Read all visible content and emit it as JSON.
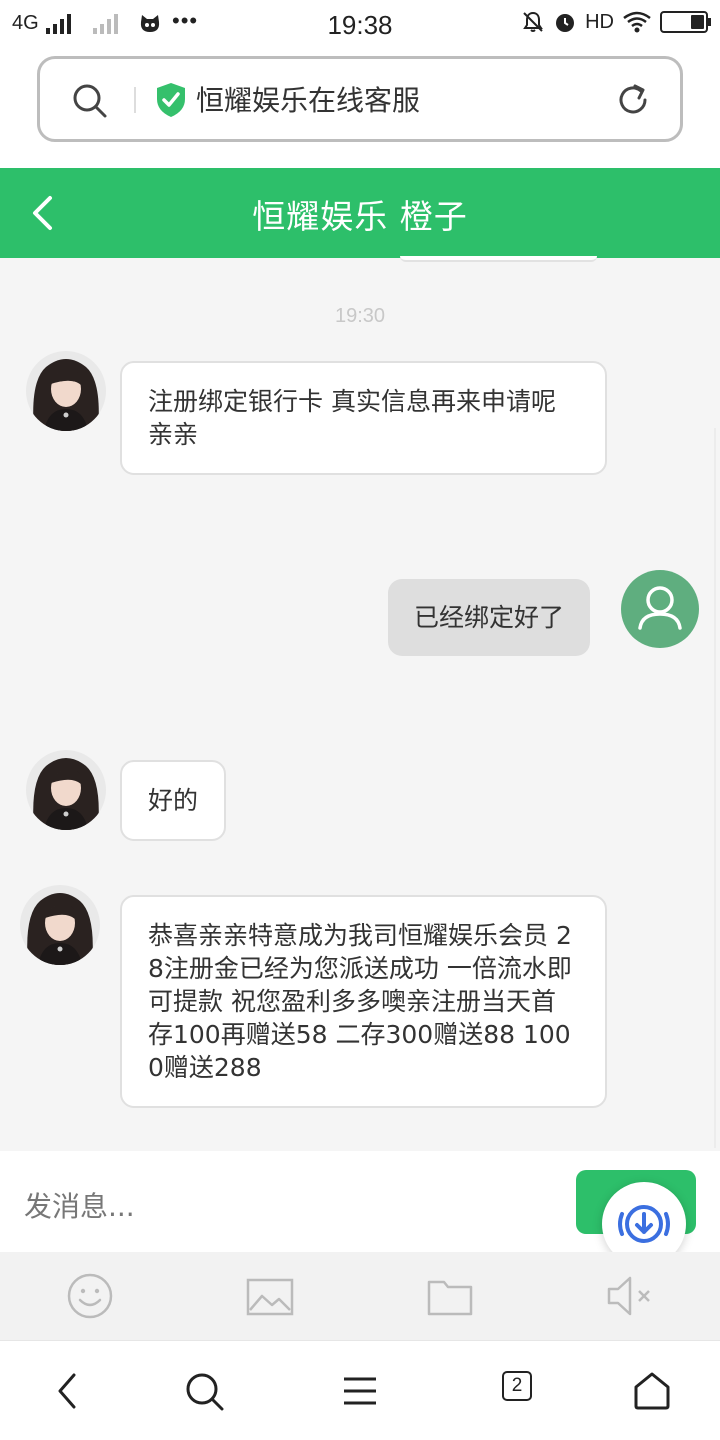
{
  "status_bar": {
    "network": "4G",
    "time": "19:38",
    "hd": "HD",
    "more_dots": "•••"
  },
  "browser": {
    "page_title": "恒耀娱乐在线客服"
  },
  "chat_header": {
    "title": "恒耀娱乐 橙子"
  },
  "messages": {
    "timestamp": "19:30",
    "items": [
      {
        "from": "agent",
        "text": "注册绑定银行卡 真实信息再来申请呢亲亲"
      },
      {
        "from": "user",
        "text": "已经绑定好了"
      },
      {
        "from": "agent",
        "text": "好的"
      },
      {
        "from": "agent",
        "text": "恭喜亲亲特意成为我司恒耀娱乐会员 28注册金已经为您派送成功 一倍流水即可提款 祝您盈利多多噢亲注册当天首存100再赠送58 二存300赠送88 1000赠送288"
      }
    ]
  },
  "composer": {
    "placeholder": "发消息..."
  },
  "bottom_nav": {
    "tab_count": "2"
  },
  "colors": {
    "accent": "#2dbf6a",
    "user_avatar": "#5fae7f",
    "fab_icon": "#3b6fe0"
  },
  "icons": {
    "toolbar": [
      "emoji-icon",
      "image-icon",
      "folder-icon",
      "mute-icon"
    ],
    "nav": [
      "back-icon",
      "search-icon",
      "menu-icon",
      "tabs-icon",
      "home-icon"
    ]
  }
}
